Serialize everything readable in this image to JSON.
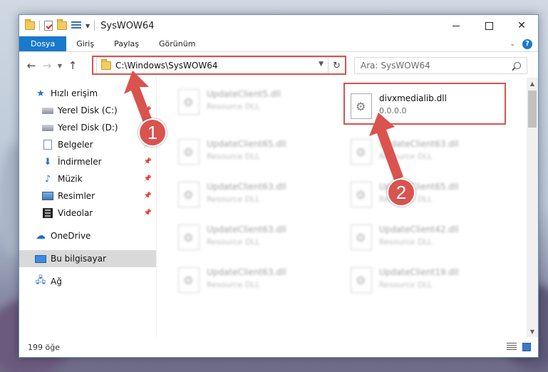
{
  "window": {
    "title": "SysWOW64",
    "controls": {
      "minimize": "—",
      "maximize": "☐",
      "close": "✕"
    }
  },
  "ribbon": {
    "tabs": [
      "Dosya",
      "Giriş",
      "Paylaş",
      "Görünüm"
    ]
  },
  "address": {
    "path": "C:\\Windows\\SysWOW64",
    "search_placeholder": "Ara: SysWOW64"
  },
  "sidebar": {
    "items": [
      {
        "label": "Hızlı erişim",
        "icon": "star-icon",
        "pinned": false
      },
      {
        "label": "Yerel Disk (C:)",
        "icon": "disk-icon",
        "pinned": true
      },
      {
        "label": "Yerel Disk (D:)",
        "icon": "disk-icon",
        "pinned": true
      },
      {
        "label": "Belgeler",
        "icon": "document-icon",
        "pinned": true
      },
      {
        "label": "İndirmeler",
        "icon": "download-icon",
        "pinned": true
      },
      {
        "label": "Müzik",
        "icon": "music-icon",
        "pinned": true
      },
      {
        "label": "Resimler",
        "icon": "pictures-icon",
        "pinned": true
      },
      {
        "label": "Videolar",
        "icon": "video-icon",
        "pinned": true
      },
      {
        "label": "OneDrive",
        "icon": "cloud-icon",
        "pinned": false
      },
      {
        "label": "Bu bilgisayar",
        "icon": "computer-icon",
        "pinned": false,
        "selected": true
      },
      {
        "label": "Ağ",
        "icon": "network-icon",
        "pinned": false
      }
    ]
  },
  "files": {
    "highlighted": {
      "name": "divxmedialib.dll",
      "desc": "0.0.0.0"
    },
    "blurred_left": [
      {
        "name": "UpdateClient5.dll",
        "desc": "Resource DLL"
      },
      {
        "name": "UpdateClient65.dll",
        "desc": "Resource DLL"
      },
      {
        "name": "UpdateClient63.dll",
        "desc": "Resource DLL"
      },
      {
        "name": "UpdateClient63.dll",
        "desc": "Resource DLL"
      },
      {
        "name": "UpdateClient63.dll",
        "desc": "Resource DLL"
      }
    ],
    "blurred_right": [
      {
        "name": "UpdateClient63.dll",
        "desc": "Resource DLL"
      },
      {
        "name": "UpdateClient65.dll",
        "desc": "Resource DLL"
      },
      {
        "name": "UpdateClient42.dll",
        "desc": "Resource DLL"
      },
      {
        "name": "UpdateClient19.dll",
        "desc": "Resource DLL"
      }
    ]
  },
  "annotations": {
    "badge1": "1",
    "badge2": "2",
    "color": "#d9534f"
  },
  "status": {
    "item_count": "199 öğe"
  }
}
